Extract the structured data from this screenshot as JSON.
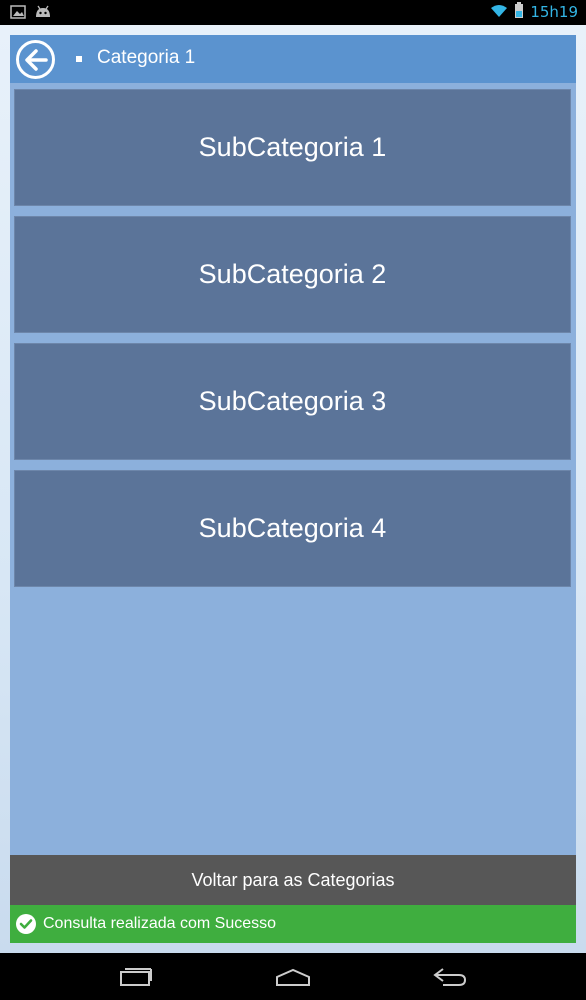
{
  "status_bar": {
    "time": "15h19",
    "icons": [
      "image-notification-icon",
      "android-notification-icon",
      "wifi-icon",
      "battery-icon"
    ],
    "accent_color": "#33b5e5"
  },
  "header": {
    "title": "Categoria 1",
    "back_icon": "arrow-left-circle-icon"
  },
  "subcategories": [
    {
      "label": "SubCategoria 1"
    },
    {
      "label": "SubCategoria 2"
    },
    {
      "label": "SubCategoria 3"
    },
    {
      "label": "SubCategoria 4"
    }
  ],
  "footer": {
    "back_label": "Voltar para as Categorias",
    "status_message": "Consulta realizada com Sucesso",
    "status_color": "#3fae3f"
  },
  "nav_bar": {
    "buttons": [
      "recent-apps-icon",
      "home-icon",
      "back-icon"
    ]
  },
  "colors": {
    "header": "#5b93cf",
    "tile": "#5b7499",
    "panel": "#8cb0dc",
    "back_bar": "#575757"
  }
}
